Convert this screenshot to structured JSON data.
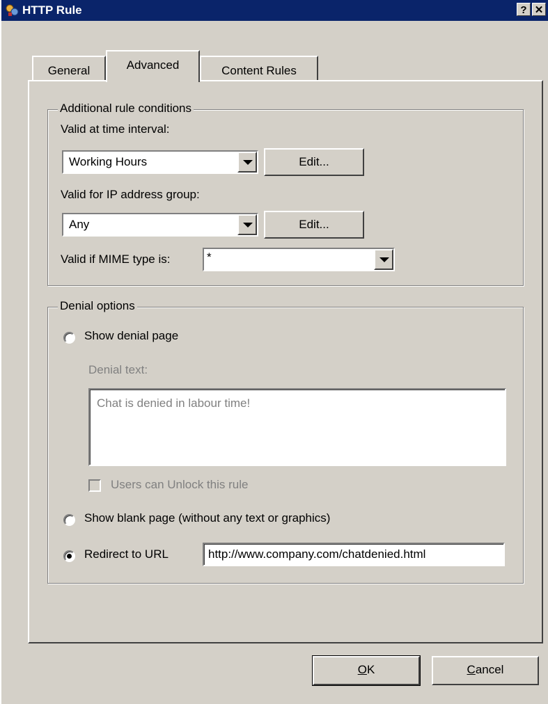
{
  "window": {
    "title": "HTTP Rule",
    "help_button": "?",
    "close_button": "✕"
  },
  "tabs": [
    {
      "label": "General",
      "active": false
    },
    {
      "label": "Advanced",
      "active": true
    },
    {
      "label": "Content Rules",
      "active": false
    }
  ],
  "conditions": {
    "legend": "Additional rule conditions",
    "time_label": "Valid at time interval:",
    "time_value": "Working Hours",
    "time_edit": "Edit...",
    "ip_label": "Valid for IP address group:",
    "ip_value": "Any",
    "ip_edit": "Edit...",
    "mime_label": "Valid if MIME type is:",
    "mime_value": "*"
  },
  "denial": {
    "legend": "Denial options",
    "show_denial_label": "Show denial page",
    "denial_text_label": "Denial text:",
    "denial_text": "Chat is denied in labour time!",
    "unlock_label": "Users can Unlock this rule",
    "blank_label": "Show blank page (without any text or graphics)",
    "redirect_label": "Redirect to URL",
    "redirect_url": "http://www.company.com/chatdenied.html",
    "selected": "redirect"
  },
  "buttons": {
    "ok_accel": "O",
    "ok_rest": "K",
    "cancel_accel": "C",
    "cancel_rest": "ancel"
  }
}
